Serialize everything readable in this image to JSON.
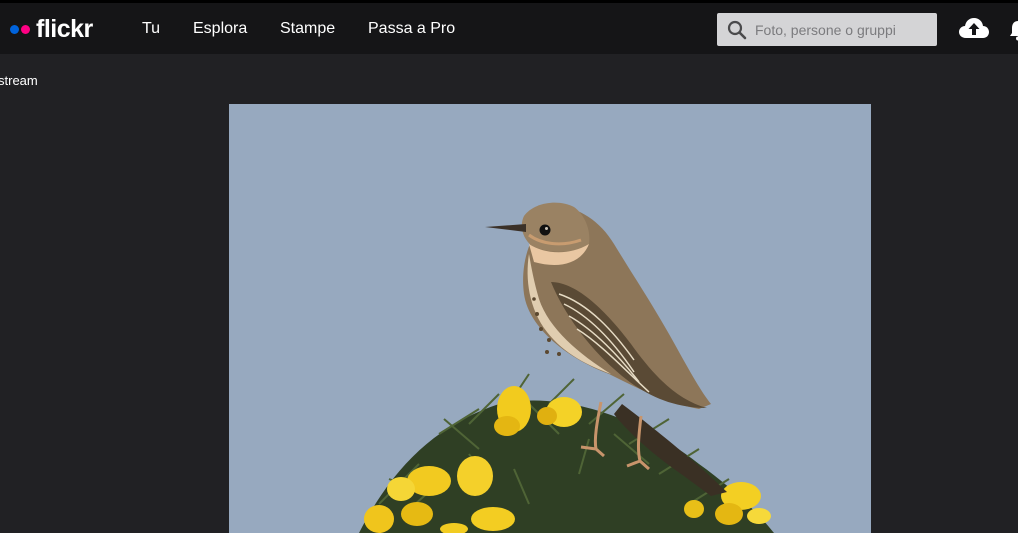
{
  "header": {
    "logo": "flickr",
    "nav": [
      "Tu",
      "Esplora",
      "Stampe",
      "Passa a Pro"
    ],
    "search": {
      "placeholder": "Foto, persone o gruppi",
      "value": ""
    },
    "icons": [
      "search-icon",
      "upload-cloud-icon",
      "notifications-bell-icon"
    ]
  },
  "breadcrumb": {
    "text": "stream"
  },
  "photo": {
    "subject": "bird-on-gorse-photo"
  },
  "colors": {
    "background": "#212124",
    "topbar": "#151517",
    "logo_blue": "#0063dc",
    "logo_pink": "#ff0084",
    "sky": "#97a9bf"
  }
}
